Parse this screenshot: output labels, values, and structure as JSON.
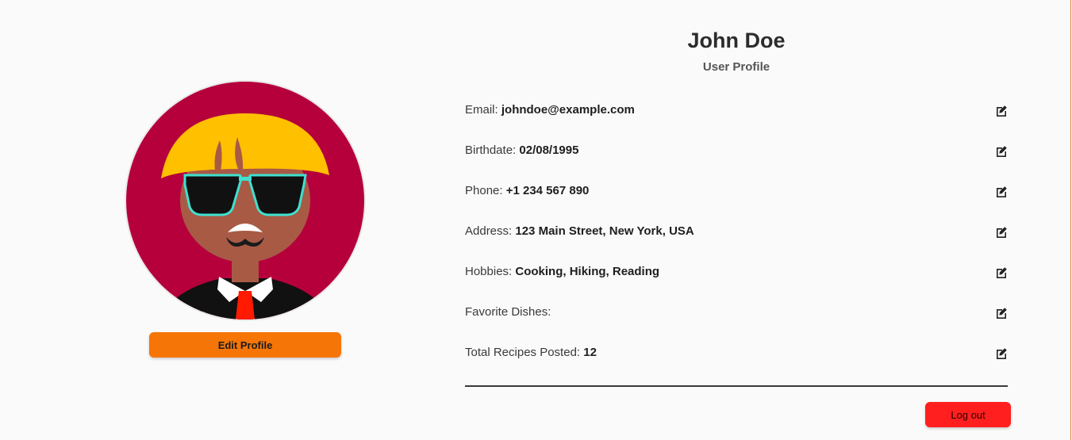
{
  "profile": {
    "name": "John Doe",
    "subtitle": "User Profile",
    "edit_button": "Edit Profile",
    "logout_button": "Log out"
  },
  "fields": [
    {
      "label": "Email:",
      "value": "johndoe@example.com"
    },
    {
      "label": "Birthdate:",
      "value": "02/08/1995"
    },
    {
      "label": "Phone:",
      "value": "+1 234 567 890"
    },
    {
      "label": "Address:",
      "value": "123 Main Street, New York, USA"
    },
    {
      "label": "Hobbies:",
      "value": "Cooking, Hiking, Reading"
    },
    {
      "label": "Favorite Dishes:",
      "value": ""
    },
    {
      "label": "Total Recipes Posted:",
      "value": "12"
    }
  ],
  "colors": {
    "edit_button": "#f57607",
    "logout_button": "#ff1f1f",
    "avatar_background": "#b5003c",
    "hair": "#ffc000",
    "skin": "#a85a45",
    "glasses_frame": "#3fe0d0"
  },
  "icons": {
    "field_edit": "edit-icon",
    "avatar": "avatar-illustration"
  }
}
